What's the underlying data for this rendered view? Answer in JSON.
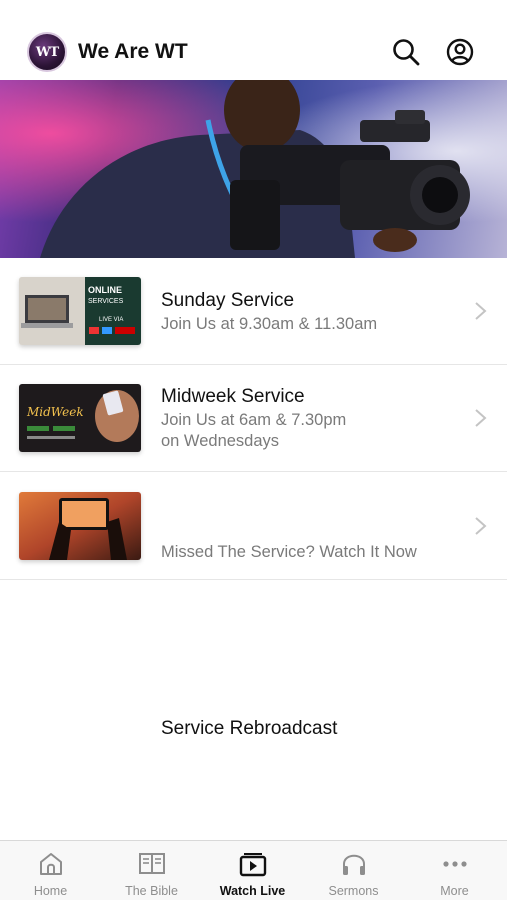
{
  "header": {
    "logo_text": "WT",
    "title": "We Are WT",
    "icons": {
      "search": "search-icon",
      "profile": "profile-icon"
    }
  },
  "hero": {
    "image": "camera-operator-photo"
  },
  "services": [
    {
      "title": "Sunday Service",
      "subtitle": "Join Us at 9.30am & 11.30am",
      "thumb_text": "ONLINE SERVICES",
      "thumb_sub": "LIVE VIA"
    },
    {
      "title": "Midweek Service",
      "subtitle_line1": "Join Us at 6am & 7.30pm",
      "subtitle_line2": "on Wednesdays",
      "thumb_text": "MidWeek"
    },
    {
      "title": "Service Rebroadcast",
      "subtitle": "Missed The Service? Watch It Now"
    }
  ],
  "tabs": [
    {
      "label": "Home",
      "icon": "home-icon",
      "active": false
    },
    {
      "label": "The Bible",
      "icon": "book-icon",
      "active": false
    },
    {
      "label": "Watch Live",
      "icon": "play-icon",
      "active": true
    },
    {
      "label": "Sermons",
      "icon": "headphones-icon",
      "active": false
    },
    {
      "label": "More",
      "icon": "more-icon",
      "active": false
    }
  ],
  "colors": {
    "accent": "#111111",
    "inactive_tab": "#8e8e8e",
    "subtitle": "#7a7a7a"
  }
}
